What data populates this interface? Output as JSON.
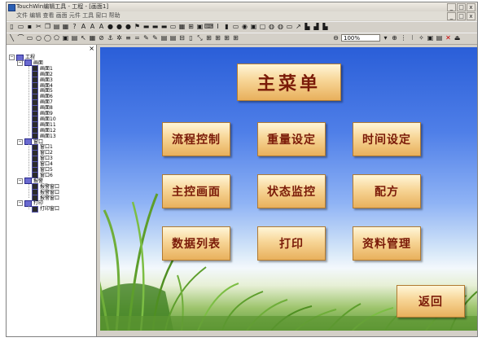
{
  "window": {
    "title": "TouchWin编辑工具 - 工程 - [画面1]",
    "menubar_text": "文件 编辑 查看 画面 元件 工具 窗口 帮助",
    "controls": [
      "_",
      "□",
      "x"
    ]
  },
  "toolbar": {
    "zoom_value": "100%"
  },
  "tree": {
    "root": "工程",
    "groups": [
      {
        "label": "画面",
        "items": [
          "画面1",
          "画面2",
          "画面3",
          "画面4",
          "画面5",
          "画面6",
          "画面7",
          "画面8",
          "画面9",
          "画面10",
          "画面11",
          "画面12",
          "画面13"
        ]
      },
      {
        "label": "窗口",
        "items": [
          "窗口1",
          "窗口2",
          "窗口3",
          "窗口4",
          "窗口5",
          "窗口6"
        ]
      },
      {
        "label": "报警",
        "items": [
          "报警窗口",
          "报警窗口",
          "报警窗口"
        ]
      },
      {
        "label": "打印",
        "items": [
          "打印窗口"
        ]
      }
    ]
  },
  "screen": {
    "title": "主菜单",
    "buttons": [
      "流程控制",
      "重量设定",
      "时间设定",
      "主控画面",
      "状态监控",
      "配方",
      "数据列表",
      "打印",
      "资料管理"
    ],
    "return_label": "返回"
  }
}
